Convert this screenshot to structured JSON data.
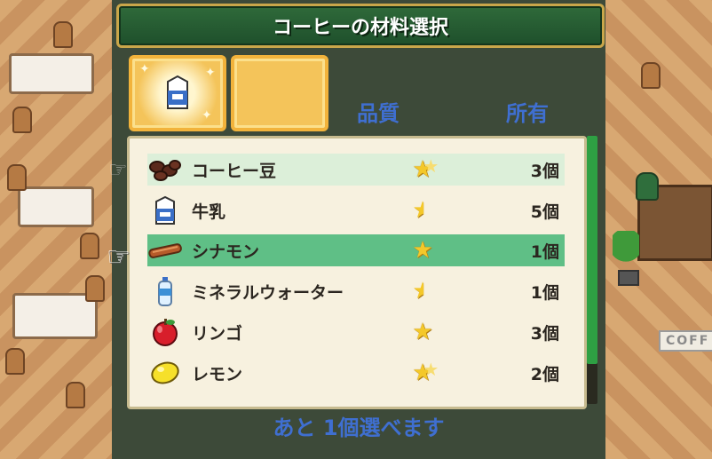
{
  "window": {
    "title": "コーヒーの材料選択"
  },
  "slots": [
    {
      "filled_with": "牛乳",
      "icon": "milk-carton-icon"
    },
    {
      "filled_with": "",
      "icon": ""
    }
  ],
  "columns": {
    "quality": "品質",
    "owned": "所有"
  },
  "items": [
    {
      "name": "コーヒー豆",
      "icon": "coffee-beans-icon",
      "quality_stars": 2,
      "quality_style": "double-star",
      "count": "3個",
      "highlight": "light"
    },
    {
      "name": "牛乳",
      "icon": "milk-carton-icon",
      "quality_stars": 0.5,
      "quality_style": "half-star",
      "count": "5個",
      "highlight": "none"
    },
    {
      "name": "シナモン",
      "icon": "cinnamon-stick-icon",
      "quality_stars": 1,
      "quality_style": "single-star",
      "count": "1個",
      "highlight": "selected"
    },
    {
      "name": "ミネラルウォーター",
      "icon": "water-bottle-icon",
      "quality_stars": 0.5,
      "quality_style": "half-star",
      "count": "1個",
      "highlight": "none"
    },
    {
      "name": "リンゴ",
      "icon": "apple-icon",
      "quality_stars": 1,
      "quality_style": "single-star",
      "count": "3個",
      "highlight": "none"
    },
    {
      "name": "レモン",
      "icon": "lemon-icon",
      "quality_stars": 2,
      "quality_style": "double-star",
      "count": "2個",
      "highlight": "none"
    }
  ],
  "footer": {
    "remaining_text": "あと 1個選べます"
  },
  "scrollbar": {
    "visible_fraction": 0.85
  },
  "background": {
    "sign_text": "COFF"
  },
  "colors": {
    "title_bg": "#2f6a3a",
    "accent_blue": "#3f6fd1",
    "selected_row": "#5fbf86",
    "star": "#f4c82a"
  }
}
